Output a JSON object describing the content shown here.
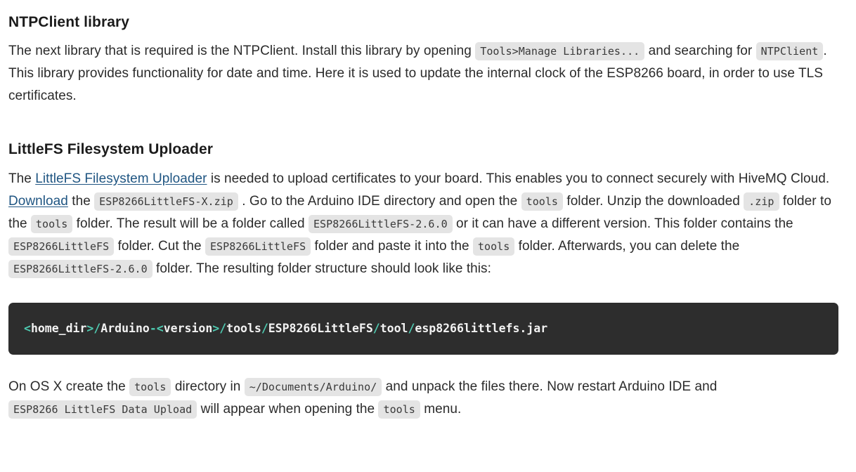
{
  "document": {
    "sections": [
      {
        "heading": "NTPClient library",
        "paragraph": {
          "seg1": "The next library that is required is the NTPClient. Install this library by opening",
          "code1": "Tools>Manage Libraries...",
          "seg2": "and searching for",
          "code2": "NTPClient",
          "seg3": ". This library provides functionality for date and time. Here it is used to update the internal clock of the ESP8266 board, in order to use TLS certificates."
        }
      },
      {
        "heading": "LittleFS Filesystem Uploader",
        "paragraph": {
          "seg1": "The",
          "link1": "LittleFS Filesystem Uploader",
          "seg2": "is needed to upload certificates to your board. This enables you to connect securely with HiveMQ Cloud.",
          "link2": "Download",
          "seg3": "the",
          "code1": "ESP8266LittleFS-X.zip",
          "seg4": ". Go to the Arduino IDE directory and open the",
          "code2": "tools",
          "seg5": "folder. Unzip the downloaded",
          "code3": ".zip",
          "seg6": "folder to the",
          "code4": "tools",
          "seg7": "folder. The result will be a folder called",
          "code5": "ESP8266LittleFS-2.6.0",
          "seg8": "or it can have a different version. This folder contains the",
          "code6": "ESP8266LittleFS",
          "seg9": "folder. Cut the",
          "code7": "ESP8266LittleFS",
          "seg10": "folder and paste it into the",
          "code8": "tools",
          "seg11": "folder. Afterwards, you can delete the",
          "code9": "ESP8266LittleFS-2.6.0",
          "seg12": "folder. The resulting folder structure should look like this:"
        }
      }
    ],
    "codeblock": {
      "tokens": [
        {
          "text": "<",
          "type": "punct"
        },
        {
          "text": "home_dir",
          "type": "plain"
        },
        {
          "text": ">/",
          "type": "punct"
        },
        {
          "text": "Arduino",
          "type": "plain"
        },
        {
          "text": "-<",
          "type": "punct"
        },
        {
          "text": "version",
          "type": "plain"
        },
        {
          "text": ">/",
          "type": "punct"
        },
        {
          "text": "tools",
          "type": "plain"
        },
        {
          "text": "/",
          "type": "punct"
        },
        {
          "text": "ESP8266LittleFS",
          "type": "plain"
        },
        {
          "text": "/",
          "type": "punct"
        },
        {
          "text": "tool",
          "type": "plain"
        },
        {
          "text": "/",
          "type": "punct"
        },
        {
          "text": "esp8266littlefs.jar",
          "type": "plain"
        }
      ],
      "plain_text": "<home_dir>/Arduino-<version>/tools/ESP8266LittleFS/tool/esp8266littlefs.jar"
    },
    "final_paragraph": {
      "seg1": "On OS X create the",
      "code1": "tools",
      "seg2": "directory in",
      "code2": "~/Documents/Arduino/",
      "seg3": "and unpack the files there. Now restart Arduino IDE and",
      "code3": "ESP8266 LittleFS Data Upload",
      "seg4": "will appear when opening the",
      "code4": "tools",
      "seg5": "menu."
    }
  },
  "colors": {
    "link": "#1f5582",
    "inline_code_bg": "#e4e4e4",
    "codeblock_bg": "#2d2d2d",
    "codeblock_punct": "#4ec9b0",
    "text": "#2b2b2b"
  }
}
